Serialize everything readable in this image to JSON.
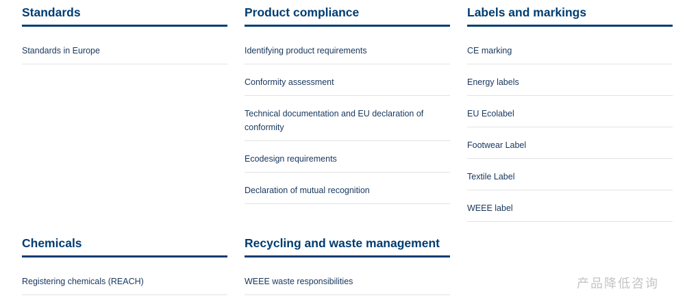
{
  "sections": [
    {
      "title": "Standards",
      "links": [
        "Standards in Europe"
      ]
    },
    {
      "title": "Product compliance",
      "links": [
        "Identifying product requirements",
        "Conformity assessment",
        "Technical documentation and EU declaration of conformity",
        "Ecodesign requirements",
        "Declaration of mutual recognition"
      ]
    },
    {
      "title": "Labels and markings",
      "links": [
        "CE marking",
        "Energy labels",
        "EU Ecolabel",
        "Footwear Label",
        "Textile Label",
        "WEEE label"
      ]
    },
    {
      "title": "Chemicals",
      "links": [
        "Registering chemicals (REACH)"
      ]
    },
    {
      "title": "Recycling and waste management",
      "links": [
        "WEEE waste responsibilities"
      ]
    }
  ],
  "watermark": {
    "text": "产品降低咨询"
  }
}
